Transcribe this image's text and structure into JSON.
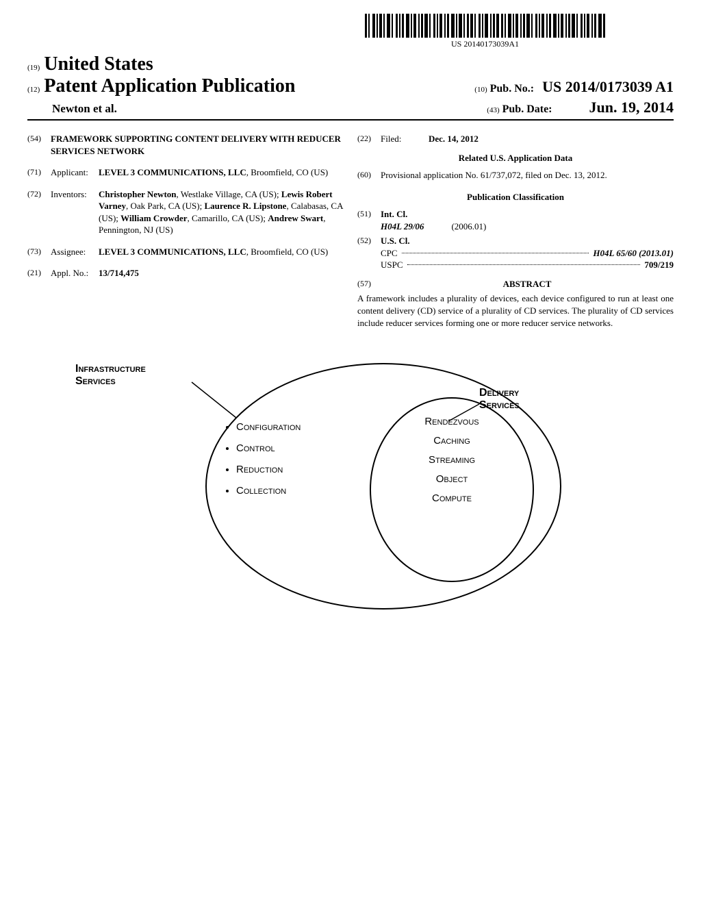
{
  "barcode_text": "US 20140173039A1",
  "header": {
    "inid_19": "(19)",
    "country": "United States",
    "inid_12": "(12)",
    "pub_type": "Patent Application Publication",
    "author": "Newton et al.",
    "inid_10": "(10)",
    "pub_no_label": "Pub. No.:",
    "pub_no": "US 2014/0173039 A1",
    "inid_43": "(43)",
    "pub_date_label": "Pub. Date:",
    "pub_date": "Jun. 19, 2014"
  },
  "left_col": {
    "f54": {
      "code": "(54)",
      "title": "FRAMEWORK SUPPORTING CONTENT DELIVERY WITH REDUCER SERVICES NETWORK"
    },
    "f71": {
      "code": "(71)",
      "label": "Applicant:",
      "value_bold": "LEVEL 3 COMMUNICATIONS, LLC",
      "value_rest": ", Broomfield, CO (US)"
    },
    "f72": {
      "code": "(72)",
      "label": "Inventors:",
      "inv1_name": "Christopher Newton",
      "inv1_loc": ", Westlake Village, CA (US); ",
      "inv2_name": "Lewis Robert Varney",
      "inv2_loc": ", Oak Park, CA (US); ",
      "inv3_name": "Laurence R. Lipstone",
      "inv3_loc": ", Calabasas, CA (US); ",
      "inv4_name": "William Crowder",
      "inv4_loc": ", Camarillo, CA (US); ",
      "inv5_name": "Andrew Swart",
      "inv5_loc": ", Pennington, NJ (US)"
    },
    "f73": {
      "code": "(73)",
      "label": "Assignee:",
      "value_bold": "LEVEL 3 COMMUNICATIONS, LLC",
      "value_rest": ", Broomfield, CO (US)"
    },
    "f21": {
      "code": "(21)",
      "label": "Appl. No.:",
      "value": "13/714,475"
    }
  },
  "right_col": {
    "f22": {
      "code": "(22)",
      "label": "Filed:",
      "value": "Dec. 14, 2012"
    },
    "related_heading": "Related U.S. Application Data",
    "f60": {
      "code": "(60)",
      "text": "Provisional application No. 61/737,072, filed on Dec. 13, 2012."
    },
    "pub_class_heading": "Publication Classification",
    "f51": {
      "code": "(51)",
      "label": "Int. Cl.",
      "class": "H04L 29/06",
      "year": "(2006.01)"
    },
    "f52": {
      "code": "(52)",
      "label": "U.S. Cl.",
      "cpc_label": "CPC",
      "cpc_value": "H04L 65/60 (2013.01)",
      "uspc_label": "USPC",
      "uspc_value": "709/219"
    },
    "f57": {
      "code": "(57)",
      "heading": "ABSTRACT",
      "text": "A framework includes a plurality of devices, each device configured to run at least one content delivery (CD) service of a plurality of CD services. The plurality of CD services include reducer services forming one or more reducer service networks."
    }
  },
  "figure": {
    "infra_label": "Infrastructure Services",
    "delivery_label": "Delivery Services",
    "infra_items": [
      "Configuration",
      "Control",
      "Reduction",
      "Collection"
    ],
    "delivery_items": [
      "Rendezvous",
      "Caching",
      "Streaming",
      "Object",
      "Compute"
    ]
  }
}
